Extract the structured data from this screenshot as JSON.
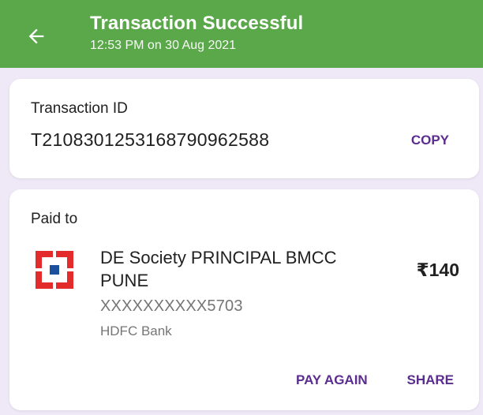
{
  "header": {
    "title": "Transaction Successful",
    "subtitle": "12:53 PM on 30 Aug 2021",
    "back_icon": "arrow-left-icon",
    "background_color": "#5aa84a"
  },
  "transaction": {
    "label": "Transaction ID",
    "id": "T2108301253168790962588",
    "copy_label": "COPY"
  },
  "paid_to": {
    "label": "Paid to",
    "payee_name": "DE Society PRINCIPAL BMCC PUNE",
    "account_number": "XXXXXXXXXX5703",
    "bank_name": "HDFC Bank",
    "bank_logo_icon": "hdfc-bank-logo-icon",
    "amount": "₹140",
    "pay_again_label": "PAY AGAIN",
    "share_label": "SHARE"
  },
  "colors": {
    "accent": "#5b2d8e",
    "page_background": "#efe8f6",
    "logo_red": "#e32b2b",
    "logo_blue": "#1c4f9c"
  }
}
